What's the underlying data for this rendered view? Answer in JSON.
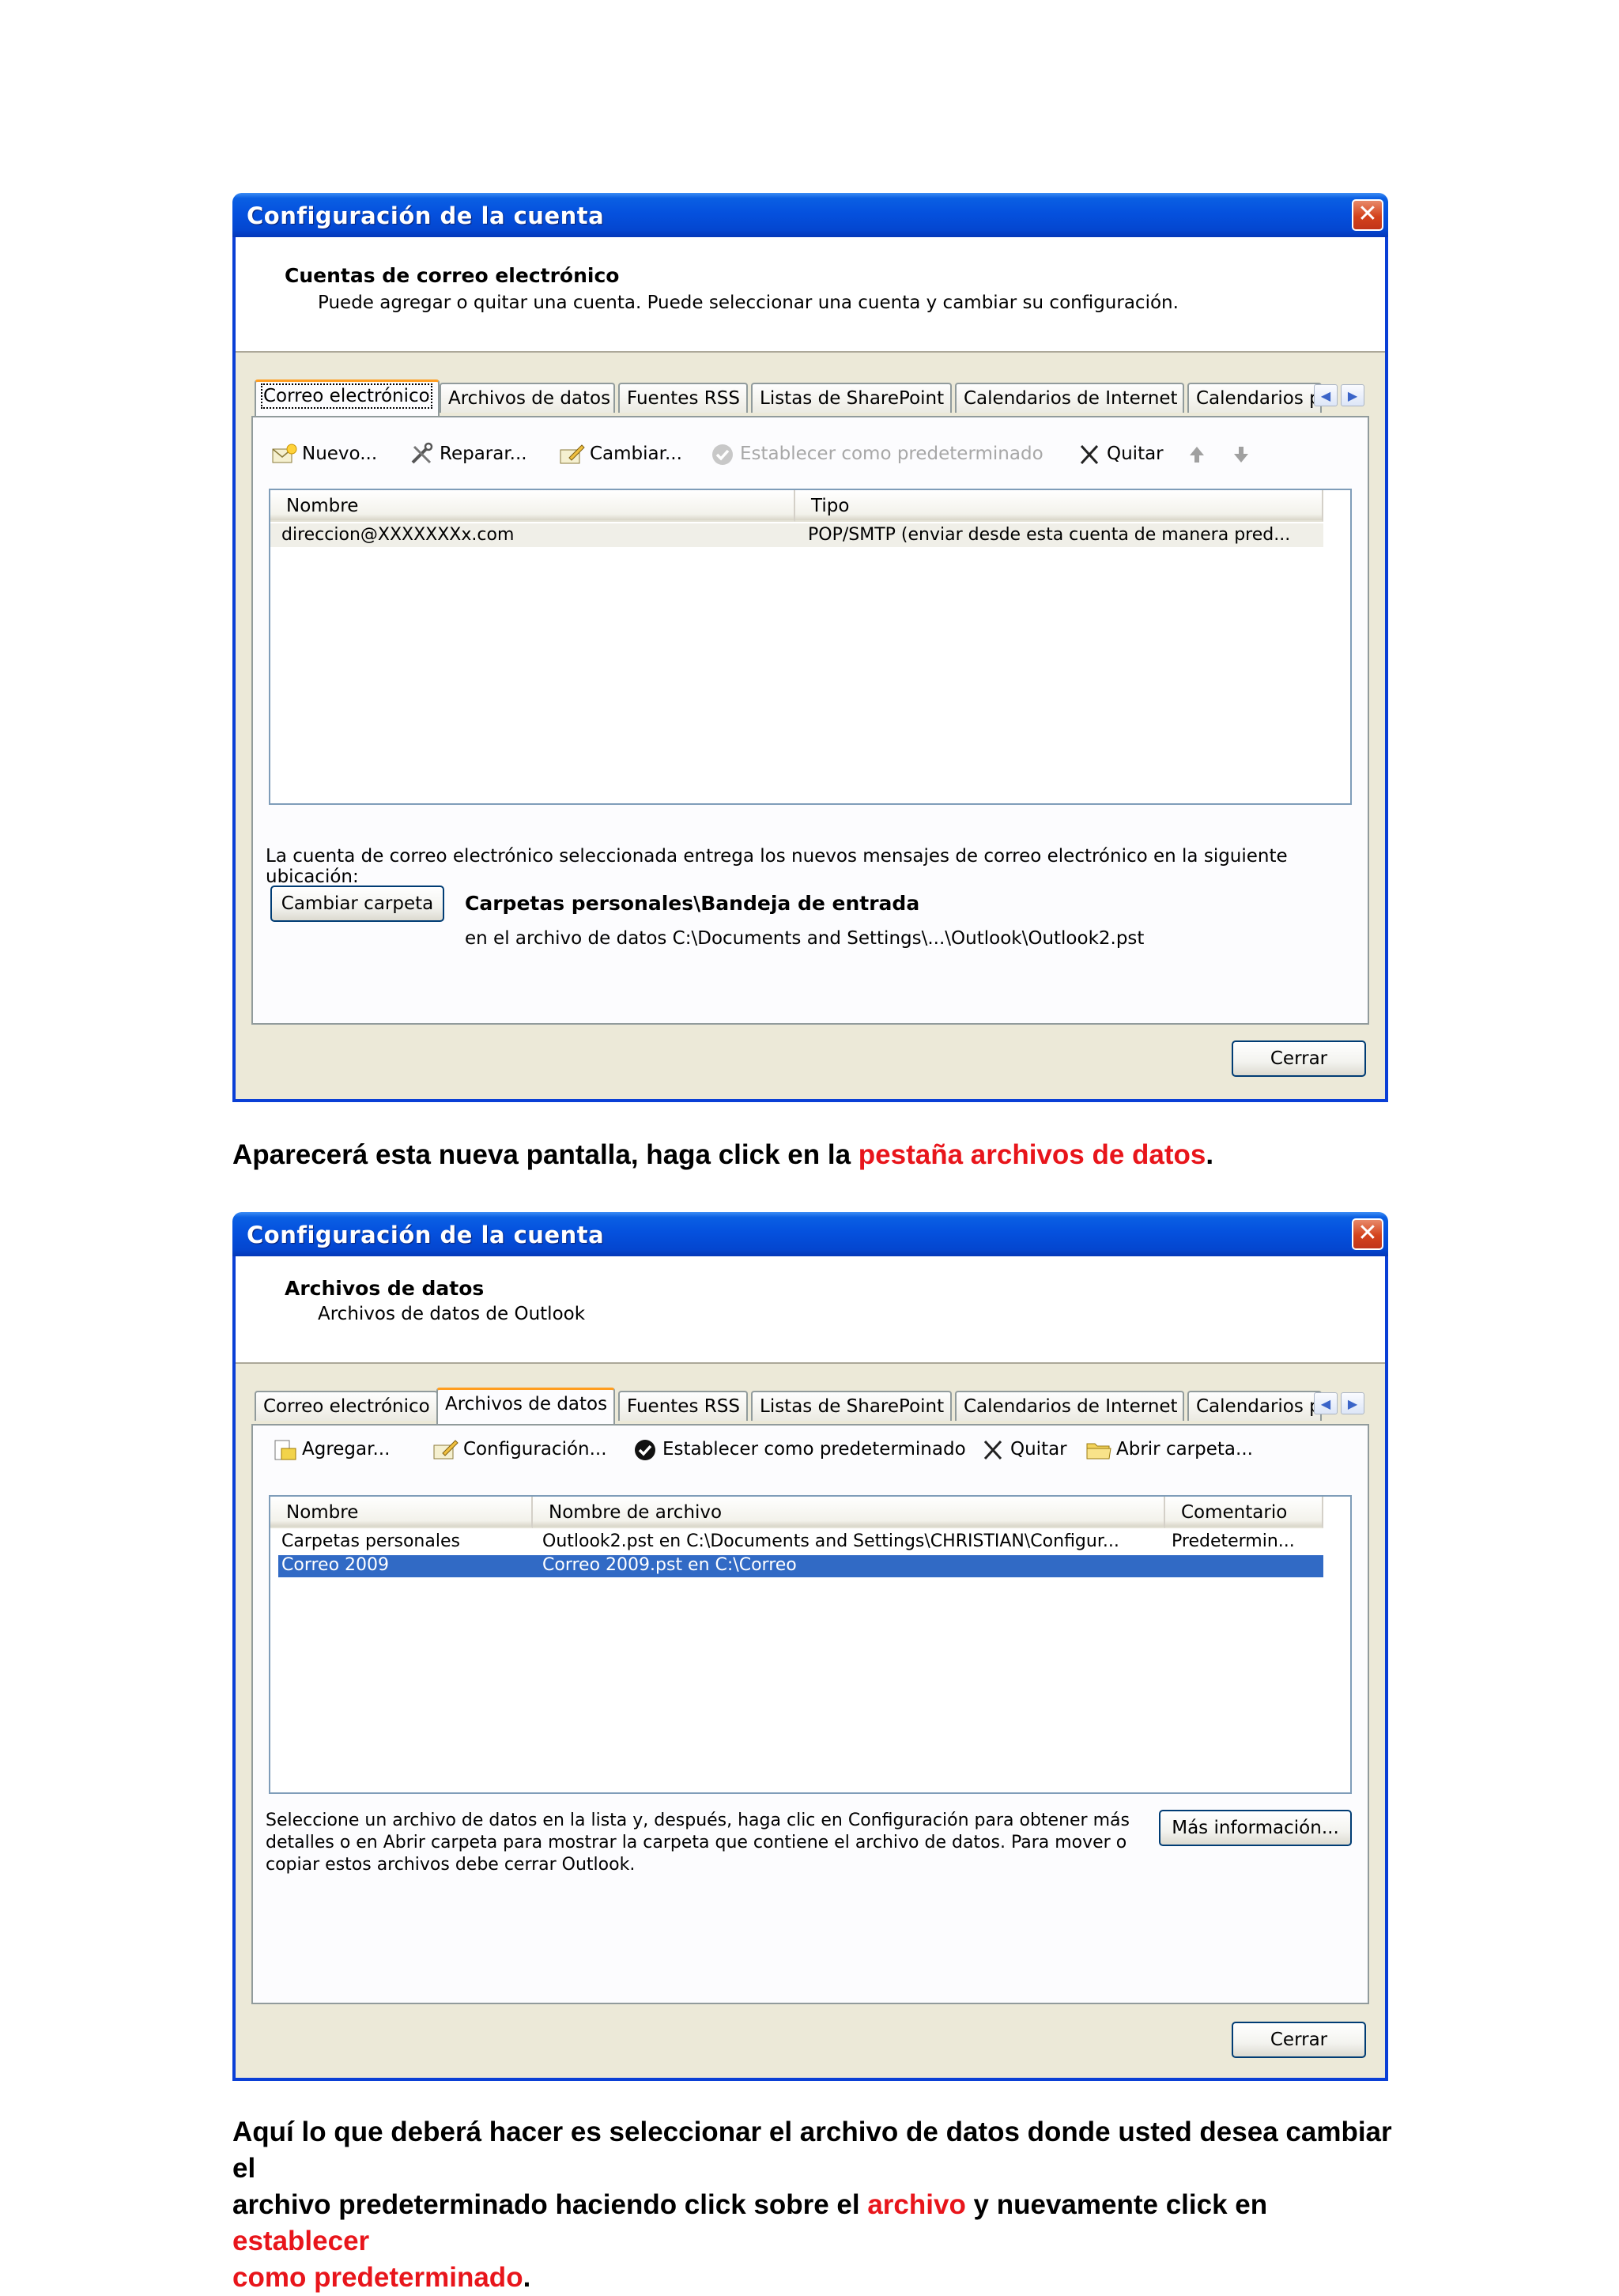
{
  "window1": {
    "title": "Configuración de la cuenta",
    "header_title": "Cuentas de correo electrónico",
    "header_sub": "Puede agregar o quitar una cuenta. Puede seleccionar una cuenta y cambiar su configuración.",
    "tabs": [
      "Correo electrónico",
      "Archivos de datos",
      "Fuentes RSS",
      "Listas de SharePoint",
      "Calendarios de Internet",
      "Calendarios p"
    ],
    "toolbar": {
      "new": "Nuevo...",
      "repair": "Reparar...",
      "change": "Cambiar...",
      "set_default": "Establecer como predeterminado",
      "remove": "Quitar"
    },
    "columns": [
      "Nombre",
      "Tipo"
    ],
    "rows": [
      {
        "name": "direccion@XXXXXXXx.com",
        "type": "POP/SMTP (enviar desde esta cuenta de manera pred..."
      }
    ],
    "delivery_text": "La cuenta de correo electrónico seleccionada entrega los nuevos mensajes de correo electrónico en la siguiente ubicación:",
    "change_folder_button": "Cambiar carpeta",
    "folder_path": "Carpetas personales\\Bandeja de entrada",
    "data_file_path": "en el archivo de datos C:\\Documents and Settings\\...\\Outlook\\Outlook2.pst",
    "close_button": "Cerrar"
  },
  "instruction1": {
    "prefix": "Aparecerá esta nueva pantalla, haga click en la ",
    "highlight": "pestaña archivos de datos",
    "suffix": "."
  },
  "window2": {
    "title": "Configuración de la cuenta",
    "header_title": "Archivos de datos",
    "header_sub": "Archivos de datos de Outlook",
    "tabs": [
      "Correo electrónico",
      "Archivos de datos",
      "Fuentes RSS",
      "Listas de SharePoint",
      "Calendarios de Internet",
      "Calendarios p"
    ],
    "toolbar": {
      "add": "Agregar...",
      "settings": "Configuración...",
      "set_default": "Establecer como predeterminado",
      "remove": "Quitar",
      "open_folder": "Abrir carpeta..."
    },
    "columns": [
      "Nombre",
      "Nombre de archivo",
      "Comentario"
    ],
    "rows": [
      {
        "name": "Carpetas personales",
        "file": "Outlook2.pst en C:\\Documents and Settings\\CHRISTIAN\\Configur...",
        "comment": "Predetermin..."
      },
      {
        "name": "Correo 2009",
        "file": "Correo 2009.pst en C:\\Correo",
        "comment": ""
      }
    ],
    "help_text_1": "Seleccione un archivo de datos en la lista y, después, haga clic en Configuración para obtener más",
    "help_text_2": "detalles o en Abrir carpeta para mostrar la carpeta que contiene el archivo de datos. Para mover o",
    "help_text_3": "copiar estos archivos debe cerrar Outlook.",
    "more_info_button": "Más información...",
    "close_button": "Cerrar"
  },
  "instruction2": {
    "line1": "Aquí lo que deberá hacer es seleccionar el archivo de datos donde usted desea cambiar el",
    "line2_prefix": "archivo predeterminado haciendo click sobre el ",
    "line2_highlight1": "archivo",
    "line2_mid": " y nuevamente click en ",
    "line2_highlight2": "establecer",
    "line3_highlight": "como predeterminado",
    "line3_suffix": "."
  },
  "colors": {
    "title_bar": "#0551de",
    "window_border": "#0a3fd6",
    "selection": "#316ac5",
    "highlight_text": "#e8151b"
  }
}
